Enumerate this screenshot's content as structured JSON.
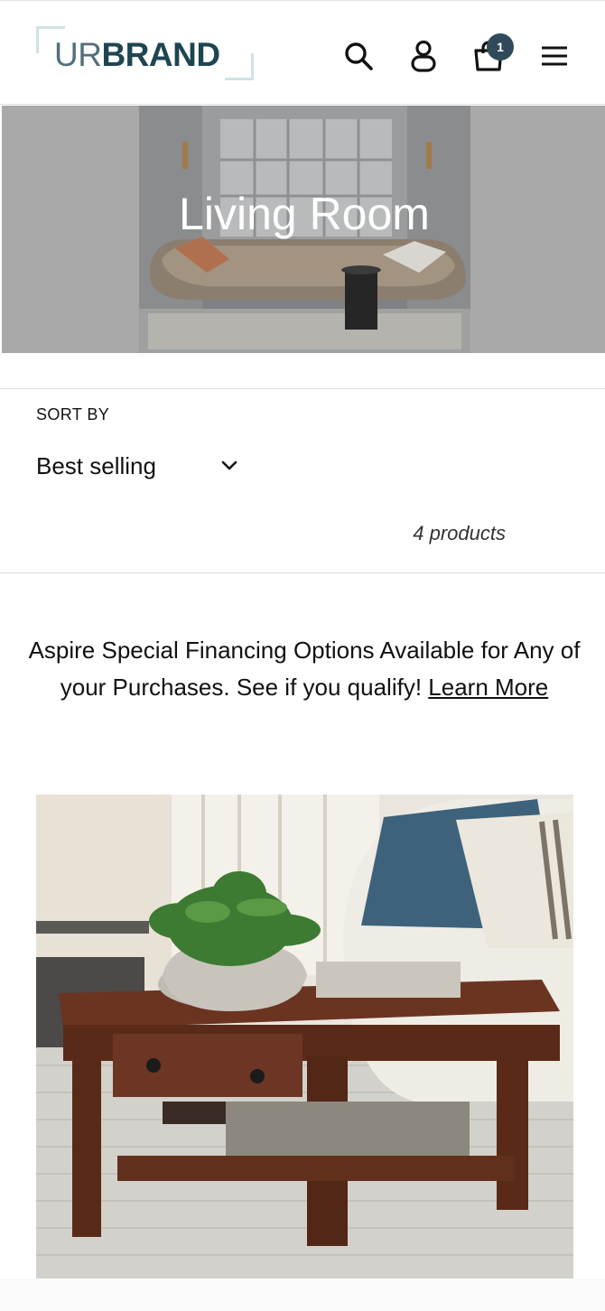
{
  "header": {
    "logo": {
      "part1": "UR",
      "part2": "BRAND"
    },
    "icons": [
      "search-icon",
      "account-icon",
      "cart-icon",
      "menu-icon"
    ],
    "cart_count": "1"
  },
  "hero": {
    "title": "Living Room",
    "overlay_color": "#a9a9a9"
  },
  "collection": {
    "sort_label": "SORT BY",
    "sort_value": "Best selling",
    "product_count": "4 products"
  },
  "promo": {
    "text": "Aspire Special Financing Options Available for Any of your Purchases. See if you qualify!",
    "link": "Learn More"
  },
  "colors": {
    "brand_dark": "#1e4552",
    "brand_light": "#52707a",
    "badge": "#304a5a"
  }
}
